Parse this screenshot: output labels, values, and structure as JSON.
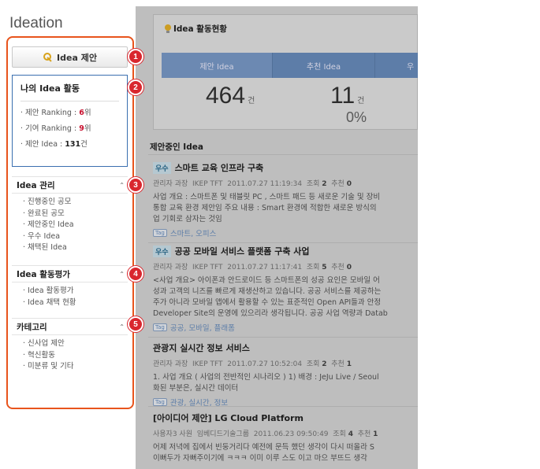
{
  "app": {
    "title": "Ideation"
  },
  "sidebar": {
    "propose_button": "Idea 제안",
    "activity": {
      "title": "나의 Idea 활동",
      "propose_rank_label": "· 제안 Ranking : ",
      "propose_rank_value": "6",
      "propose_rank_unit": "위",
      "contrib_rank_label": "· 기여 Ranking : ",
      "contrib_rank_value": "9",
      "contrib_rank_unit": "위",
      "propose_count_label": "· 제안 Idea : ",
      "propose_count_value": "131",
      "propose_count_unit": "건"
    },
    "idea_manage": {
      "title": "Idea 관리",
      "items": [
        "진행중인 공모",
        "완료된 공모",
        "제안중인 Idea",
        "우수 Idea",
        "채택된 Idea"
      ]
    },
    "idea_eval": {
      "title": "Idea 활동평가",
      "items": [
        "Idea 활동평가",
        "Idea 채택 현황"
      ]
    },
    "category": {
      "title": "카테고리",
      "items": [
        "신사업 제안",
        "혁신활동",
        "미분류 및 기타"
      ]
    }
  },
  "badges": [
    "1",
    "2",
    "3",
    "4",
    "5"
  ],
  "status": {
    "title": "Idea 활동현황",
    "tabs": [
      "제안 Idea",
      "추천 Idea",
      "우"
    ],
    "propose_count": "464",
    "propose_unit": "건",
    "recommend_count": "11",
    "recommend_unit": "건",
    "recommend_pct": "0%"
  },
  "list": {
    "title": "제안중인 Idea",
    "posts": [
      {
        "badge": "우수",
        "title": "스마트 교육 인프라 구축",
        "author": "관리자 과장",
        "dept": "IKEP TFT",
        "date": "2011.07.27 11:19:34",
        "views_label": "조회",
        "views": "2",
        "rec_label": "추천",
        "rec": "0",
        "body": [
          "사업 개요 : 스마트폰 및 태블릿 PC , 스마트 패드 등 새로운 기술 및 장비",
          "통합 교육 환경 제안임   주요 내용 : Smart 환경에 적합한 새로운 방식의",
          "업 기회로 삼자는 것임"
        ],
        "tags": "스마트, 오피스"
      },
      {
        "badge": "우수",
        "title": "공공 모바일 서비스 플랫폼 구축 사업",
        "author": "관리자 과장",
        "dept": "IKEP TFT",
        "date": "2011.07.27 11:17:41",
        "views_label": "조회",
        "views": "5",
        "rec_label": "추천",
        "rec": "0",
        "body": [
          "<사업 개요> 아이폰과 안드로이드 등 스마트폰의 성공 요인은 모바일 어",
          "성과 고객의 니즈를 빠르게 재생산하고 있습니다. 공공 서비스를 제공하는",
          "주가 아니라 모바일 앱에서 활용할 수 있는 표준적인 Open API들과 안정",
          "Developer Site의 운영에 있으리라 생각됩니다.   공공 사업 역량과 Datab"
        ],
        "tags": "공공, 모바일, 플래폼"
      },
      {
        "badge": "",
        "title": "관광지 실시간 정보 서비스",
        "author": "관리자 과장",
        "dept": "IKEP TFT",
        "date": "2011.07.27 10:52:04",
        "views_label": "조회",
        "views": "2",
        "rec_label": "추천",
        "rec": "1",
        "body": [
          "1. 사업 개요 ( 사업의 전반적인 시나리오 )  1) 배경 : JeJu Live / Seoul",
          "화된 부분은, 실시간 데이터"
        ],
        "tags": "관광, 실시간, 정보"
      },
      {
        "badge": "",
        "title": "[아이디어 제안] LG Cloud Platform",
        "author": "사용자3 사원",
        "dept": "임베디드기술그룹",
        "date": "2011.06.23 09:50:49",
        "views_label": "조회",
        "views": "4",
        "rec_label": "추천",
        "rec": "1",
        "body": [
          "어제 저녁에 집에서 빈둥거리다 예전에 문득 했던 생각이 다시 떠올라   S",
          "이뻐두가 자뻐주이기에 ㅋㅋㅋ   이미 이루 스도 이고 마으 부뜨드 생각"
        ],
        "tags": ""
      }
    ]
  },
  "colors": {
    "badge": "#d9272e",
    "highlight_border": "#e8541c",
    "accent_blue": "#6a8fc0"
  }
}
